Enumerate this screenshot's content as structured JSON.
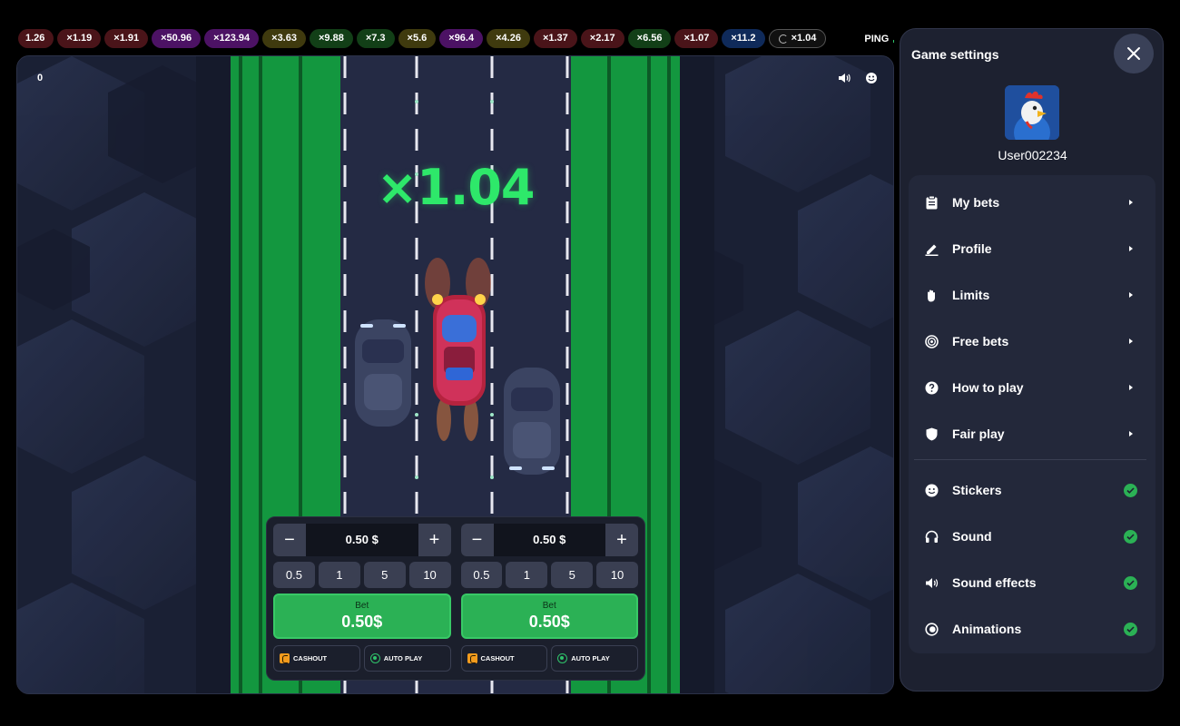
{
  "history": {
    "items": [
      {
        "label": "1.26",
        "color": "red"
      },
      {
        "label": "×1.19",
        "color": "red"
      },
      {
        "label": "×1.91",
        "color": "red"
      },
      {
        "label": "×50.96",
        "color": "purple"
      },
      {
        "label": "×123.94",
        "color": "purple"
      },
      {
        "label": "×3.63",
        "color": "olive"
      },
      {
        "label": "×9.88",
        "color": "green"
      },
      {
        "label": "×7.3",
        "color": "green"
      },
      {
        "label": "×5.6",
        "color": "olive"
      },
      {
        "label": "×96.4",
        "color": "purple"
      },
      {
        "label": "×4.26",
        "color": "olive"
      },
      {
        "label": "×1.37",
        "color": "red"
      },
      {
        "label": "×2.17",
        "color": "red"
      },
      {
        "label": "×6.56",
        "color": "green"
      },
      {
        "label": "×1.07",
        "color": "red"
      },
      {
        "label": "×11.2",
        "color": "blue"
      }
    ],
    "current": "×1.04",
    "ping_label": "PING"
  },
  "game": {
    "score": "0",
    "multiplier": "×1.04",
    "icons": [
      "sound-icon",
      "emoji-icon"
    ]
  },
  "bets": [
    {
      "amount": "0.50 $",
      "quick": [
        "0.5",
        "1",
        "5",
        "10"
      ],
      "bet_label": "Bet",
      "bet_amount": "0.50$",
      "cashout_label": "CASHOUT",
      "autoplay_label": "AUTO PLAY"
    },
    {
      "amount": "0.50 $",
      "quick": [
        "0.5",
        "1",
        "5",
        "10"
      ],
      "bet_label": "Bet",
      "bet_amount": "0.50$",
      "cashout_label": "CASHOUT",
      "autoplay_label": "AUTO PLAY"
    }
  ],
  "settings": {
    "title": "Game settings",
    "username": "User002234",
    "nav": [
      {
        "label": "My bets",
        "icon": "clipboard-icon"
      },
      {
        "label": "Profile",
        "icon": "pen-icon"
      },
      {
        "label": "Limits",
        "icon": "hand-icon"
      },
      {
        "label": "Free bets",
        "icon": "target-icon"
      },
      {
        "label": "How to play",
        "icon": "question-icon"
      },
      {
        "label": "Fair play",
        "icon": "shield-icon"
      }
    ],
    "toggles": [
      {
        "label": "Stickers",
        "icon": "smile-icon",
        "on": true
      },
      {
        "label": "Sound",
        "icon": "headphones-icon",
        "on": true
      },
      {
        "label": "Sound effects",
        "icon": "speaker-icon",
        "on": true
      },
      {
        "label": "Animations",
        "icon": "animation-icon",
        "on": true
      }
    ]
  },
  "colors": {
    "accent_green": "#2bb155",
    "multiplier_green": "#2ee86a",
    "road_green": "#13973f",
    "panel_bg": "#1d2130"
  }
}
